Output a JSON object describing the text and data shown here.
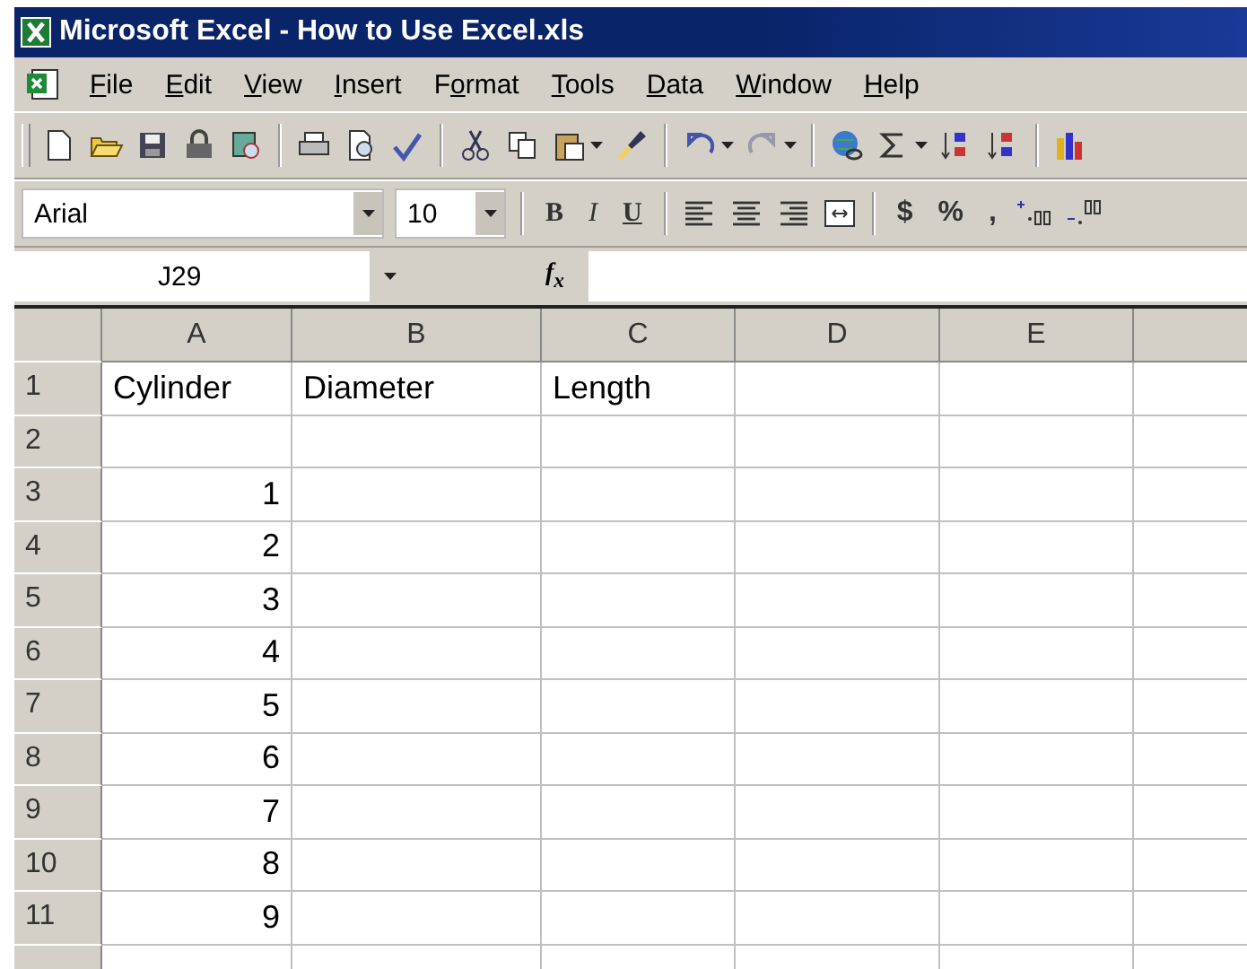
{
  "window": {
    "title": "Microsoft Excel - How to Use Excel.xls"
  },
  "menu": [
    {
      "key": "F",
      "after": "ile"
    },
    {
      "key": "E",
      "after": "dit"
    },
    {
      "key": "V",
      "after": "iew"
    },
    {
      "key": "I",
      "after": "nsert"
    },
    {
      "before": "F",
      "key": "o",
      "after": "rmat"
    },
    {
      "key": "T",
      "after": "ools"
    },
    {
      "key": "D",
      "after": "ata"
    },
    {
      "key": "W",
      "after": "indow"
    },
    {
      "key": "H",
      "after": "elp"
    }
  ],
  "formatting": {
    "font": "Arial",
    "size": "10",
    "bold": "B",
    "italic": "I",
    "underline": "U",
    "currency": "$",
    "percent": "%",
    "comma": ","
  },
  "formula_bar": {
    "name_box": "J29",
    "fx": "f$_{x}$"
  },
  "sheet": {
    "columns": [
      "A",
      "B",
      "C",
      "D",
      "E"
    ],
    "rows": [
      {
        "number": "1",
        "cells": [
          {
            "text": "Cylinder",
            "kind": "label"
          },
          {
            "text": "Diameter",
            "kind": "label"
          },
          {
            "text": "Length",
            "kind": "label"
          }
        ]
      },
      {
        "number": "2"
      },
      {
        "number": "3",
        "cells": [
          {
            "text": "1",
            "kind": "number"
          }
        ]
      },
      {
        "number": "4",
        "cells": [
          {
            "text": "2",
            "kind": "number"
          }
        ]
      },
      {
        "number": "5",
        "cells": [
          {
            "text": "3",
            "kind": "number"
          }
        ]
      },
      {
        "number": "6",
        "cells": [
          {
            "text": "4",
            "kind": "number"
          }
        ]
      },
      {
        "number": "7",
        "cells": [
          {
            "text": "5",
            "kind": "number"
          }
        ]
      },
      {
        "number": "8",
        "cells": [
          {
            "text": "6",
            "kind": "number"
          }
        ]
      },
      {
        "number": "9",
        "cells": [
          {
            "text": "7",
            "kind": "number"
          }
        ]
      },
      {
        "number": "10",
        "cells": [
          {
            "text": "8",
            "kind": "number"
          }
        ]
      },
      {
        "number": "11",
        "cells": [
          {
            "text": "9",
            "kind": "number"
          }
        ]
      }
    ]
  }
}
